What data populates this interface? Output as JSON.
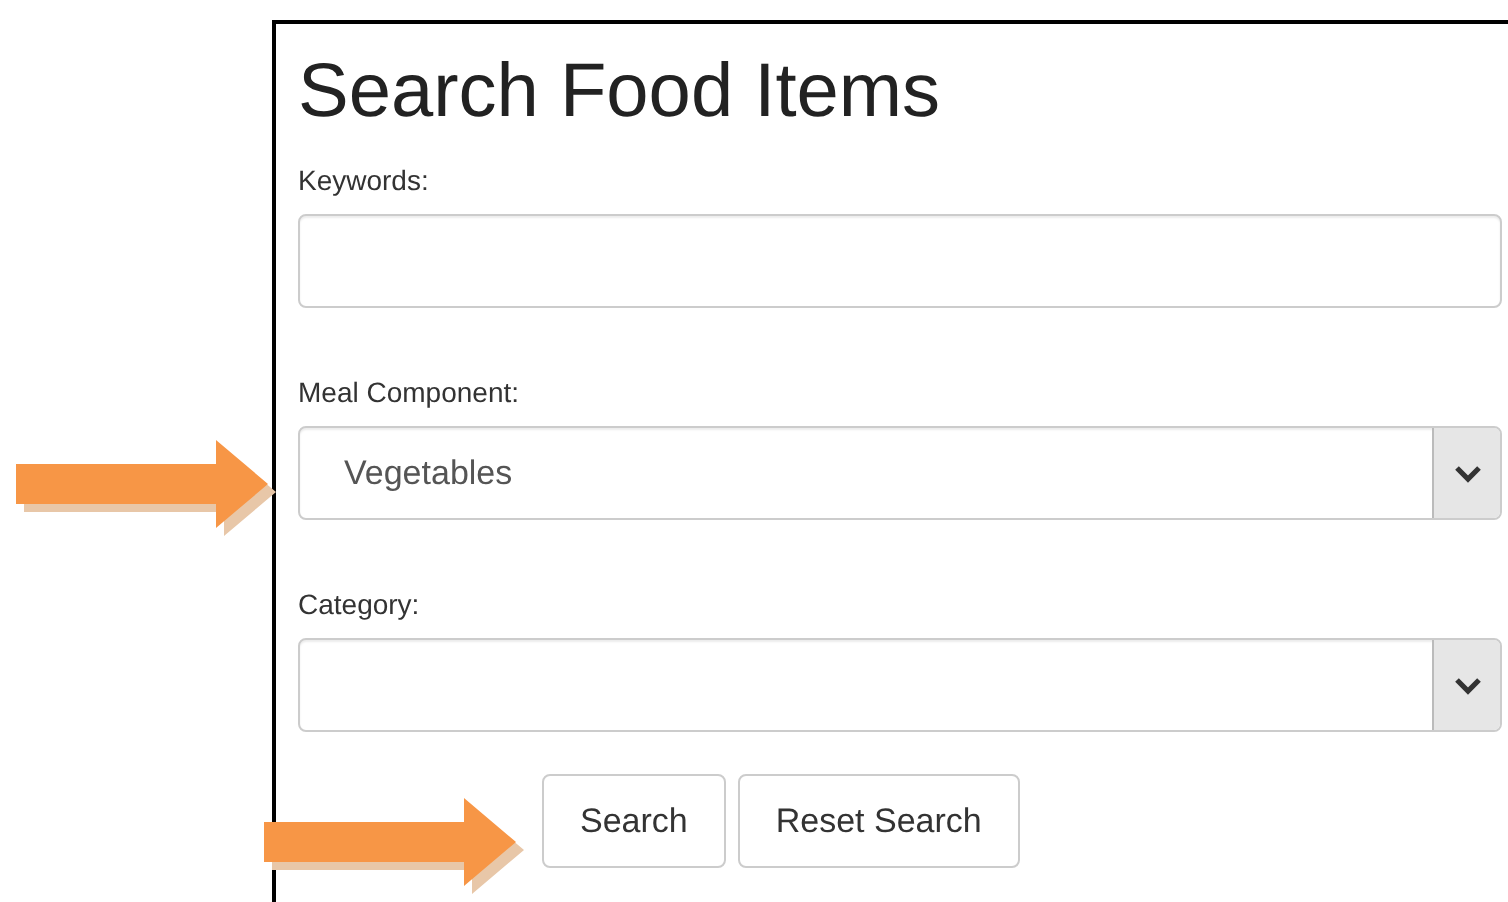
{
  "title": "Search Food Items",
  "fields": [
    {
      "kind": "text",
      "label": "Keywords:"
    },
    {
      "kind": "select",
      "label": "Meal Component:",
      "value": "Vegetables"
    },
    {
      "kind": "select",
      "label": "Category:"
    }
  ],
  "buttons": [
    "Search",
    "Reset Search"
  ]
}
